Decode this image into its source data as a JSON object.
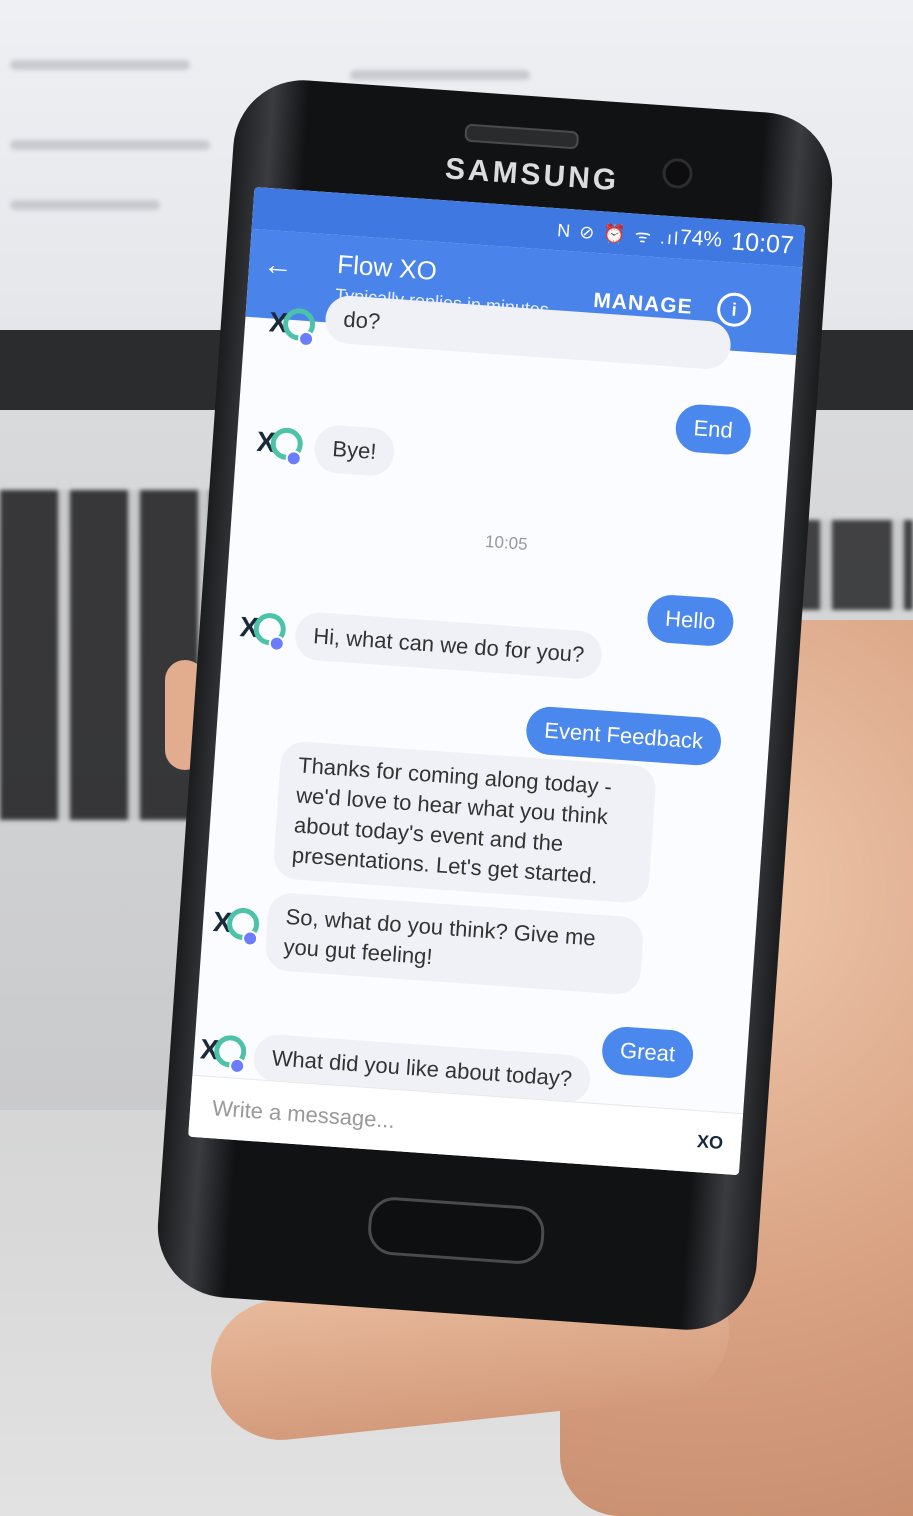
{
  "phone": {
    "brand": "SAMSUNG"
  },
  "status_bar": {
    "icons": "N ⊘ ⏰ ᯤ .ıl",
    "battery": "74%",
    "time": "10:07"
  },
  "header": {
    "title": "Flow XO",
    "subtitle": "Typically replies in minutes",
    "manage_label": "MANAGE",
    "info_icon": "i"
  },
  "chat": {
    "partial_top": "do?",
    "m_end": "End",
    "m_bye": "Bye!",
    "timestamp": "10:05",
    "m_hello": "Hello",
    "m_hi": "Hi, what can we do for you?",
    "m_event": "Event Feedback",
    "m_thanks": "Thanks for coming along today -\nwe'd love to hear what you think\nabout today's event and the\npresentations. Let's get started.",
    "m_sowhat": "So, what do you think? Give me\nyou gut feeling!",
    "m_great": "Great",
    "m_whatlike": "What did you like about today?"
  },
  "composer": {
    "placeholder": "Write a message...",
    "logo": "XO"
  },
  "colors": {
    "header_blue": "#4a83ea",
    "user_bubble": "#4a88ee",
    "avatar_teal": "#4cc3a9"
  }
}
